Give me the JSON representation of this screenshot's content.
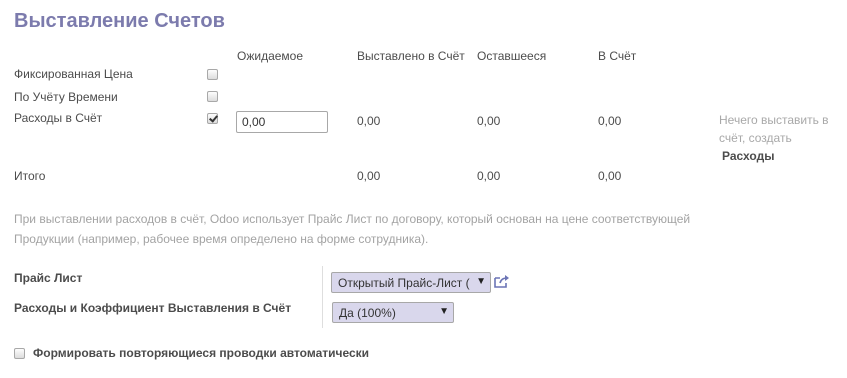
{
  "section_title": "Выставление Счетов",
  "columns": {
    "expected": "Ожидаемое",
    "invoiced": "Выставлено в Счёт",
    "remaining": "Оставшееся",
    "to_invoice": "В Счёт"
  },
  "rows": [
    {
      "label": "Фиксированная Цена",
      "checked": false
    },
    {
      "label": "По Учёту Времени",
      "checked": false
    },
    {
      "label": "Расходы в Счёт",
      "checked": true,
      "expected_value": "0,00",
      "invoiced": "0,00",
      "remaining": "0,00",
      "to_invoice": "0,00"
    }
  ],
  "total": {
    "label": "Итого",
    "invoiced": "0,00",
    "remaining": "0,00",
    "to_invoice": "0,00"
  },
  "note": {
    "text": "Нечего выставить в счёт, создать",
    "link": "Расходы"
  },
  "help_text": "При выставлении расходов в счёт, Odoo использует Прайс Лист по договору, который основан на цене соответствующей Продукции (например, рабочее время определено на форме сотрудника).",
  "pricelist": {
    "label": "Прайс Лист",
    "value": "Открытый Прайс-Лист (",
    "icon": "external-link-icon"
  },
  "invoice_factor": {
    "label": "Расходы и Коэффициент Выставления в Счёт",
    "value": "Да (100%)"
  },
  "recurring": {
    "label": "Формировать повторяющиеся проводки автоматически",
    "checked": false
  },
  "colors": {
    "title": "#7c7bad",
    "select_bg": "#d9d7ec",
    "muted": "#a3a3a3"
  }
}
